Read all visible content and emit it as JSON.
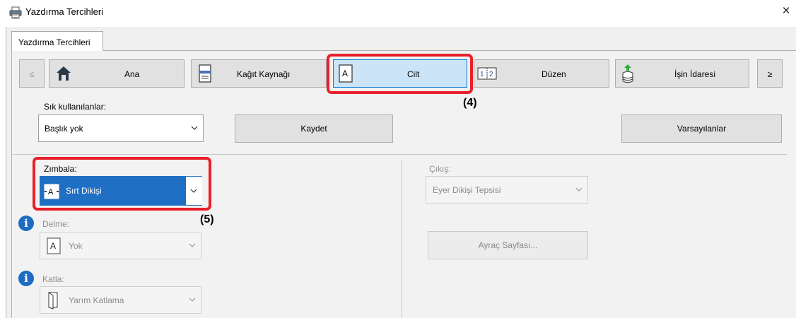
{
  "window": {
    "title": "Yazdırma Tercihleri",
    "close_glyph": "×"
  },
  "tab": {
    "label": "Yazdırma Tercihleri"
  },
  "nav": {
    "prev": "≤",
    "next": "≥",
    "items": [
      {
        "label": "Ana",
        "icon": "home-icon"
      },
      {
        "label": "Kağıt Kaynağı",
        "icon": "paper-tray-icon"
      },
      {
        "label": "Cilt",
        "icon": "binding-page-icon",
        "selected": true
      },
      {
        "label": "Düzen",
        "icon": "layout-icon"
      },
      {
        "label": "İşin İdaresi",
        "icon": "job-storage-icon"
      }
    ]
  },
  "favorites": {
    "label": "Sık kullanılanlar:",
    "value": "Başlık yok",
    "save_button": "Kaydet",
    "defaults_button": "Varsayılanlar"
  },
  "staple": {
    "label": "Zımbala:",
    "value": "Sırt Dikişi"
  },
  "punch": {
    "label": "Delme:",
    "value": "Yok"
  },
  "fold": {
    "label": "Katla:",
    "value": "Yarım Katlama"
  },
  "output": {
    "label": "Çıkış:",
    "value": "Eyer Dikişi Tepsisi",
    "separator_button": "Ayraç Sayfası..."
  },
  "callouts": {
    "tab": "(4)",
    "staple": "(5)"
  },
  "colors": {
    "accent": "#0078d7",
    "callout": "#e8202a",
    "selection": "#1f6fc4"
  }
}
